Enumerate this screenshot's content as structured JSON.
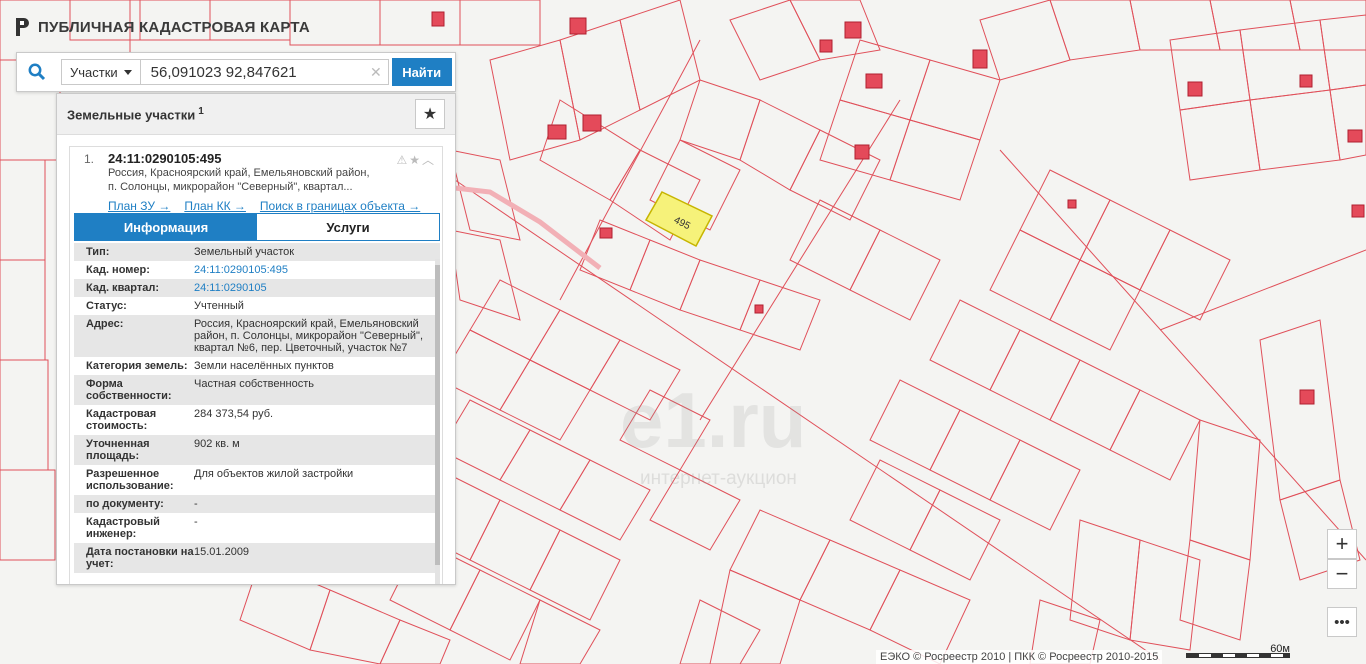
{
  "app": {
    "title": "ПУБЛИЧНАЯ КАДАСТРОВАЯ КАРТА"
  },
  "search": {
    "category": "Участки",
    "query": "56,091023 92,847621",
    "button": "Найти"
  },
  "panel": {
    "header": "Земельные участки",
    "count": "1",
    "result": {
      "index": "1.",
      "cadastral": "24:11:0290105:495",
      "address_line1": "Россия, Красноярский край, Емельяновский район,",
      "address_line2": "п. Солонцы, микрорайон \"Северный\", квартал...",
      "links": {
        "plan_zu": "План ЗУ →",
        "plan_kk": "План КК →",
        "search_bounds": "Поиск в границах объекта →"
      }
    },
    "tabs": {
      "info": "Информация",
      "services": "Услуги"
    },
    "rows": [
      {
        "k": "Тип:",
        "v": "Земельный участок",
        "link": false
      },
      {
        "k": "Кад. номер:",
        "v": "24:11:0290105:495",
        "link": true
      },
      {
        "k": "Кад. квартал:",
        "v": "24:11:0290105",
        "link": true
      },
      {
        "k": "Статус:",
        "v": "Учтенный",
        "link": false
      },
      {
        "k": "Адрес:",
        "v": "Россия, Красноярский край, Емельяновский район, п. Солонцы, микрорайон \"Северный\", квартал №6, пер. Цветочный, участок №7",
        "link": false
      },
      {
        "k": "Категория земель:",
        "v": "Земли населённых пунктов",
        "link": false
      },
      {
        "k": "Форма собственности:",
        "v": "Частная собственность",
        "link": false
      },
      {
        "k": "Кадастровая стоимость:",
        "v": "284 373,54 руб.",
        "link": false
      },
      {
        "k": "Уточненная площадь:",
        "v": "902 кв. м",
        "link": false
      },
      {
        "k": "Разрешенное использование:",
        "v": "Для объектов жилой застройки",
        "link": false
      },
      {
        "k": "по документу:",
        "v": "-",
        "link": false
      },
      {
        "k": "Кадастровый инженер:",
        "v": "-",
        "link": false
      },
      {
        "k": "Дата постановки на учет:",
        "v": "15.01.2009",
        "link": false
      }
    ]
  },
  "map": {
    "attribution": "ЕЭКО © Росреестр 2010 | ПКК © Росреестр 2010-2015",
    "scale": "60м",
    "watermark": "e1.ru",
    "watermark_sub": "интернет-аукцион",
    "zoom_in": "+",
    "zoom_out": "−",
    "more": "•••",
    "highlight_label": "495",
    "colors": {
      "parcel": "#e0505a",
      "highlight": "#f6f27a",
      "building": "#e03040",
      "accent": "#1f7fc4"
    }
  }
}
